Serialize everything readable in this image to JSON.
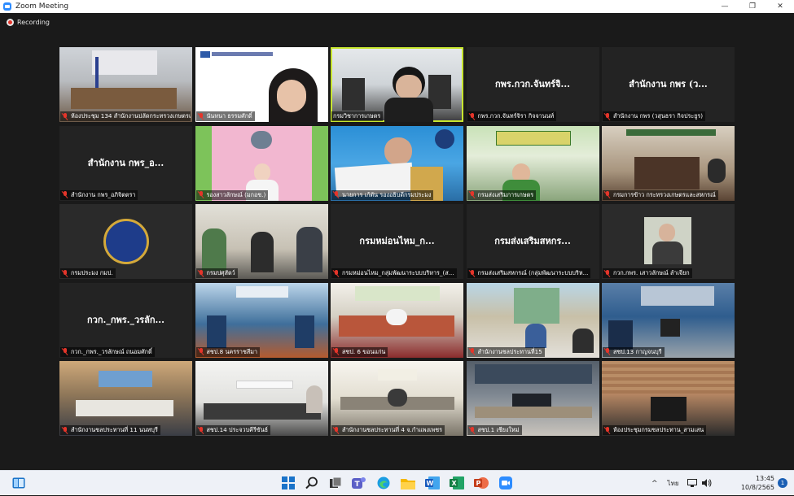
{
  "window": {
    "title": "Zoom Meeting",
    "controls": [
      "—",
      "❐",
      "✕"
    ]
  },
  "recording": {
    "label": "Recording"
  },
  "tiles": [
    {
      "label": "ห้องประชุม 134 สำนักงานปลัดกระทรวงเกษตรและสหกรณ์",
      "muted": true
    },
    {
      "label": "นันทนา ธรรมศักดิ์",
      "muted": true
    },
    {
      "label": "กรมวิชาการเกษตร",
      "muted": false
    },
    {
      "avatar": "กพร.กวก.จันทร์จิ...",
      "label": "กพร.กวก.จันทร์จิรา กิจจานนท์",
      "muted": true
    },
    {
      "avatar": "สำนักงาน กพร (ว...",
      "label": "สำนักงาน กพร (วสุนธรา กิจประยูร)",
      "muted": true
    },
    {
      "avatar": "สำนักงาน กพร_อ...",
      "label": "สำนักงาน กพร_อภิจิตตรา",
      "muted": true
    },
    {
      "label": "รองสาวลักษณ์ (มกอช.)",
      "muted": true
    },
    {
      "label": "นายการ เก้ตัน รองอธิบดีกรมประมง",
      "muted": true
    },
    {
      "label": "กรมส่งเสริมการเกษตร",
      "muted": true
    },
    {
      "label": "กรมการข้าว กระทรวงเกษตรและสหกรณ์",
      "muted": true
    },
    {
      "label": "กรมประมง กมป.",
      "muted": true
    },
    {
      "label": "กรมปศุสัตว์",
      "muted": true
    },
    {
      "avatar": "กรมหม่อนไหม_ก...",
      "label": "กรมหม่อนไหม_กลุ่มพัฒนาระบบบริหาร_(ส...",
      "muted": true
    },
    {
      "avatar": "กรมส่งเสริมสหกร...",
      "label": "กรมส่งเสริมสหกรณ์ (กลุ่มพัฒนาระบบบริห...",
      "muted": true
    },
    {
      "label": "กวก.กพร. เสาวลักษณ์ ลำเจียก",
      "muted": true
    },
    {
      "avatar": "กวก._กพร._วรลัก...",
      "label": "กวก._กพร._วรลักษณ์ ถนอมศักดิ์",
      "muted": true
    },
    {
      "label": "สชป.8 นครราชสีมา",
      "muted": true
    },
    {
      "label": "สชป. 6 ขอนแก่น",
      "muted": true
    },
    {
      "label": "สำนักงานชลประทานที่15",
      "muted": true
    },
    {
      "label": "สชป.13 กาญจนบุรี",
      "muted": true
    },
    {
      "label": "สำนักงานชลประทานที่ 11 นนทบุรี",
      "muted": true
    },
    {
      "label": "สชป.14 ประจวบคีรีขันธ์",
      "muted": true
    },
    {
      "label": "สำนักงานชลประทานที่ 4 จ.กำแพงเพชร",
      "muted": true
    },
    {
      "label": "สชป.1 เชียงใหม่",
      "muted": true
    },
    {
      "label": "ห้องประชุมกรมชลประทาน_สามเสน",
      "muted": true
    }
  ],
  "taskbar": {
    "apps": [
      "start-icon",
      "search-icon",
      "task-view-icon",
      "teams-icon",
      "edge-icon",
      "file-explorer-icon",
      "word-icon",
      "excel-icon",
      "powerpoint-icon",
      "zoom-icon"
    ],
    "tray": {
      "chevron": "^",
      "language": "ไทย",
      "time": "13:45",
      "date": "10/8/2565",
      "notifications": "1"
    }
  },
  "colors": {
    "active_speaker_outline": "#c8e630",
    "muted_icon": "#e5352a",
    "zoom_blue": "#2d8cff"
  }
}
